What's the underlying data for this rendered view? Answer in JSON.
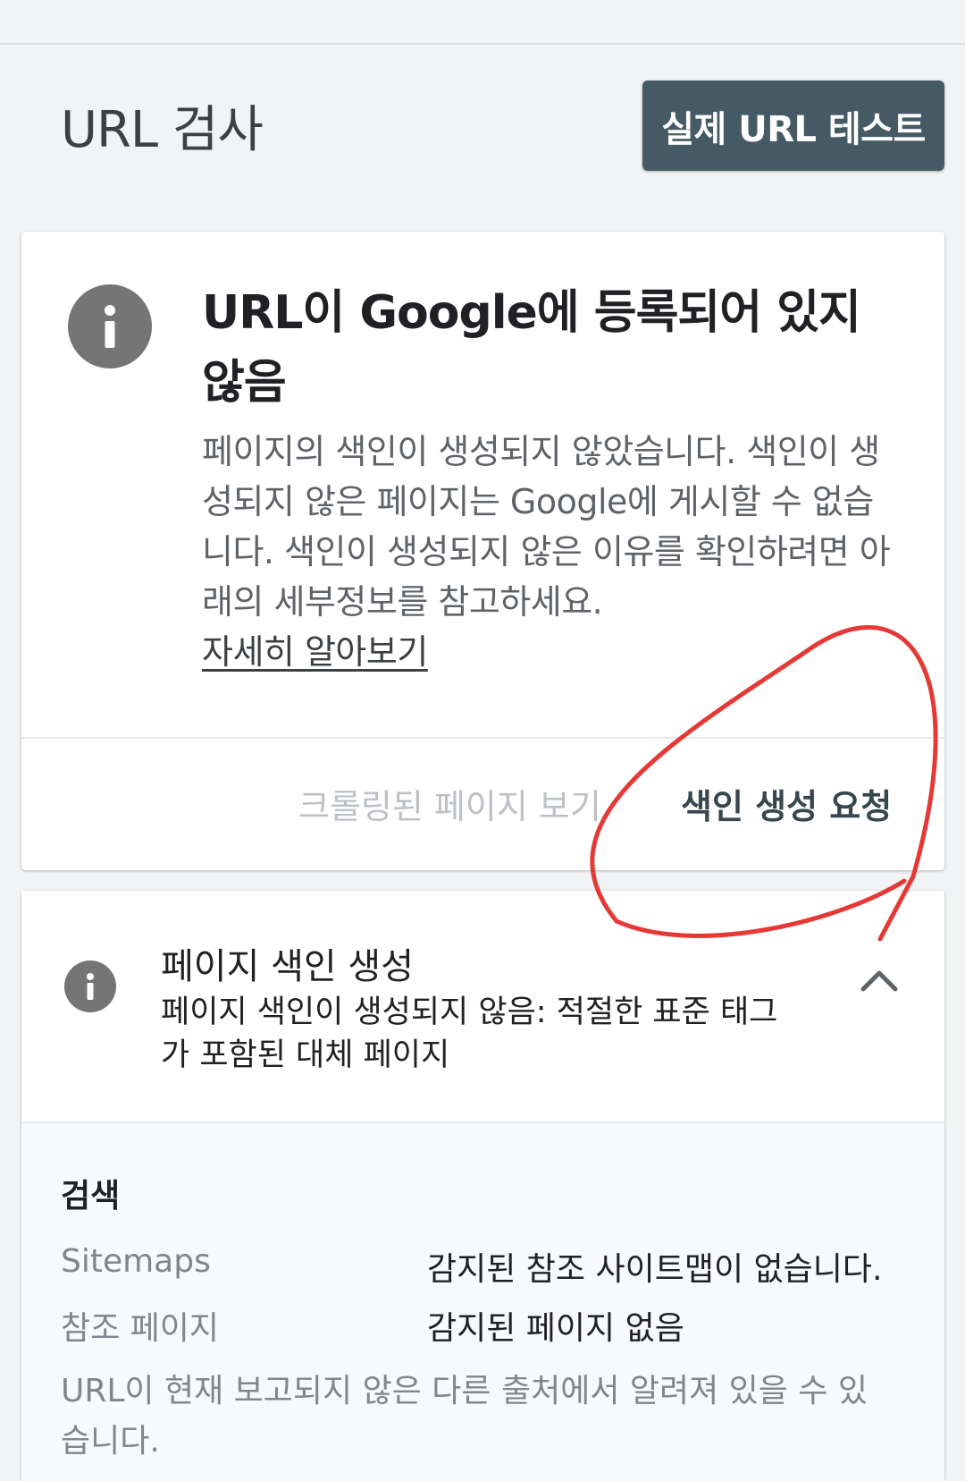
{
  "header": {
    "page_title": "URL 검사",
    "live_test_label": "실제 URL 테스트"
  },
  "status_card": {
    "icon": "info-icon",
    "heading": "URL이 Google에 등록되어 있지 않음",
    "description": "페이지의 색인이 생성되지 않았습니다. 색인이 생성되지 않은 페이지는 Google에 게시할 수 없습니다. 색인이 생성되지 않은 이유를 확인하려면 아래의 세부정보를 참고하세요.",
    "learn_more": "자세히 알아보기",
    "view_crawled_label": "크롤링된 페이지 보기",
    "request_indexing_label": "색인 생성 요청"
  },
  "indexing_card": {
    "icon": "info-icon",
    "title": "페이지 색인 생성",
    "subtitle": "페이지 색인이 생성되지 않음: 적절한 표준 태그가 포함된 대체 페이지",
    "expand_icon": "chevron-up-icon",
    "details": {
      "section_label": "검색",
      "rows": [
        {
          "key": "Sitemaps",
          "value": "감지된 참조 사이트맵이 없습니다."
        },
        {
          "key": "참조 페이지",
          "value": "감지된 페이지 없음"
        }
      ],
      "note": "URL이 현재 보고되지 않은 다른 출처에서 알려져 있을 수 있습니다."
    }
  },
  "colors": {
    "button_bg": "#455a64",
    "primary_action": "#37474f",
    "annotation_red": "#e53935",
    "icon_grey": "#757575"
  }
}
